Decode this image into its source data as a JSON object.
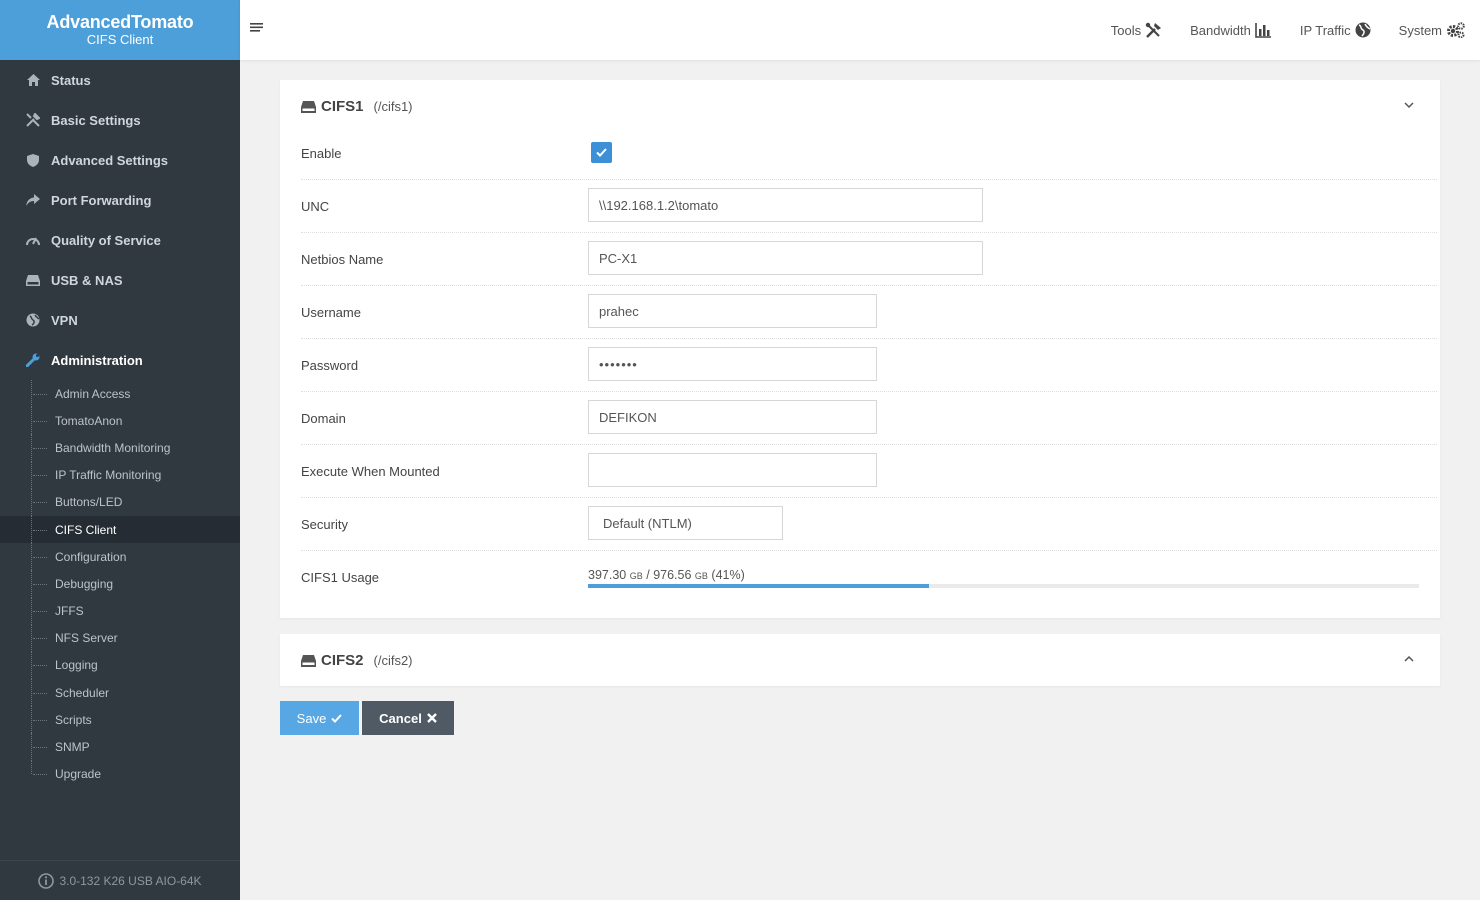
{
  "brand": {
    "title": "AdvancedTomato",
    "subtitle": "CIFS Client"
  },
  "nav": [
    {
      "label": "Status",
      "icon": "home-icon"
    },
    {
      "label": "Basic Settings",
      "icon": "tools-icon"
    },
    {
      "label": "Advanced Settings",
      "icon": "shield-icon"
    },
    {
      "label": "Port Forwarding",
      "icon": "share-arrow-icon"
    },
    {
      "label": "Quality of Service",
      "icon": "gauge-icon"
    },
    {
      "label": "USB & NAS",
      "icon": "drive-icon"
    },
    {
      "label": "VPN",
      "icon": "globe-icon"
    },
    {
      "label": "Administration",
      "icon": "wrench-icon",
      "active": true
    }
  ],
  "subnav": [
    "Admin Access",
    "TomatoAnon",
    "Bandwidth Monitoring",
    "IP Traffic Monitoring",
    "Buttons/LED",
    "CIFS Client",
    "Configuration",
    "Debugging",
    "JFFS",
    "NFS Server",
    "Logging",
    "Scheduler",
    "Scripts",
    "SNMP",
    "Upgrade"
  ],
  "subnav_active": "CIFS Client",
  "footer": {
    "version": "3.0-132 K26 USB AIO-64K"
  },
  "topbar": {
    "links": [
      {
        "label": "Tools",
        "icon": "tools-icon"
      },
      {
        "label": "Bandwidth",
        "icon": "bar-chart-icon"
      },
      {
        "label": "IP Traffic",
        "icon": "globe-icon"
      },
      {
        "label": "System",
        "icon": "gears-icon"
      }
    ]
  },
  "cifs1": {
    "title": "CIFS1",
    "mount": "(/cifs1)",
    "expanded": true,
    "fields": {
      "enable_label": "Enable",
      "enabled": true,
      "unc_label": "UNC",
      "unc": "\\\\192.168.1.2\\tomato",
      "netbios_label": "Netbios Name",
      "netbios": "PC-X1",
      "username_label": "Username",
      "username": "prahec",
      "password_label": "Password",
      "password": "•••••••",
      "domain_label": "Domain",
      "domain": "DEFIKON",
      "exec_label": "Execute When Mounted",
      "exec": "",
      "security_label": "Security",
      "security": "Default (NTLM)",
      "usage_label": "CIFS1 Usage",
      "usage_used": "397.30",
      "usage_total": "976.56",
      "usage_unit": "GB",
      "usage_separator": "/",
      "usage_percent_text": "(41%)",
      "usage_fraction": 0.41
    }
  },
  "cifs2": {
    "title": "CIFS2",
    "mount": "(/cifs2)",
    "expanded": false
  },
  "buttons": {
    "save": "Save",
    "cancel": "Cancel"
  },
  "colors": {
    "accent": "#4d9fd9",
    "sidebar": "#303840",
    "checkbox": "#3d8fd6",
    "cancel": "#4f5a64"
  }
}
